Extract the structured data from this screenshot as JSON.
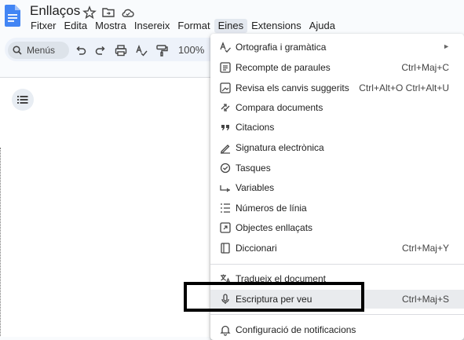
{
  "document": {
    "title": "Enllaços"
  },
  "menubar": {
    "items": [
      {
        "label": "Fitxer"
      },
      {
        "label": "Edita"
      },
      {
        "label": "Mostra"
      },
      {
        "label": "Insereix"
      },
      {
        "label": "Format"
      },
      {
        "label": "Eines"
      },
      {
        "label": "Extensions"
      },
      {
        "label": "Ajuda"
      }
    ],
    "active": "Eines"
  },
  "toolbar": {
    "search_label": "Menús",
    "zoom": "100%"
  },
  "tools_menu": {
    "items": [
      {
        "label": "Ortografia i gramàtica",
        "shortcut": "",
        "has_submenu": true,
        "icon": "spellcheck-icon"
      },
      {
        "label": "Recompte de paraules",
        "shortcut": "Ctrl+Maj+C",
        "icon": "word-count-icon"
      },
      {
        "label": "Revisa els canvis suggerits",
        "shortcut": "Ctrl+Alt+O Ctrl+Alt+U",
        "icon": "review-edits-icon"
      },
      {
        "label": "Compara documents",
        "shortcut": "",
        "icon": "compare-icon"
      },
      {
        "label": "Citacions",
        "shortcut": "",
        "icon": "quote-icon"
      },
      {
        "label": "Signatura electrònica",
        "shortcut": "",
        "icon": "signature-icon"
      },
      {
        "label": "Tasques",
        "shortcut": "",
        "icon": "tasks-icon"
      },
      {
        "label": "Variables",
        "shortcut": "",
        "icon": "variables-icon"
      },
      {
        "label": "Números de línia",
        "shortcut": "",
        "icon": "line-numbers-icon"
      },
      {
        "label": "Objectes enllaçats",
        "shortcut": "",
        "icon": "linked-objects-icon"
      },
      {
        "label": "Diccionari",
        "shortcut": "Ctrl+Maj+Y",
        "icon": "dictionary-icon"
      },
      {
        "label": "Tradueix el document",
        "shortcut": "",
        "icon": "translate-icon"
      },
      {
        "label": "Escriptura per veu",
        "shortcut": "Ctrl+Maj+S",
        "icon": "microphone-icon"
      },
      {
        "label": "Configuració de notificacions",
        "shortcut": "",
        "icon": "bell-icon"
      }
    ]
  },
  "colors": {
    "doc_blue": "#4285f4",
    "highlight_border": "#000000"
  }
}
